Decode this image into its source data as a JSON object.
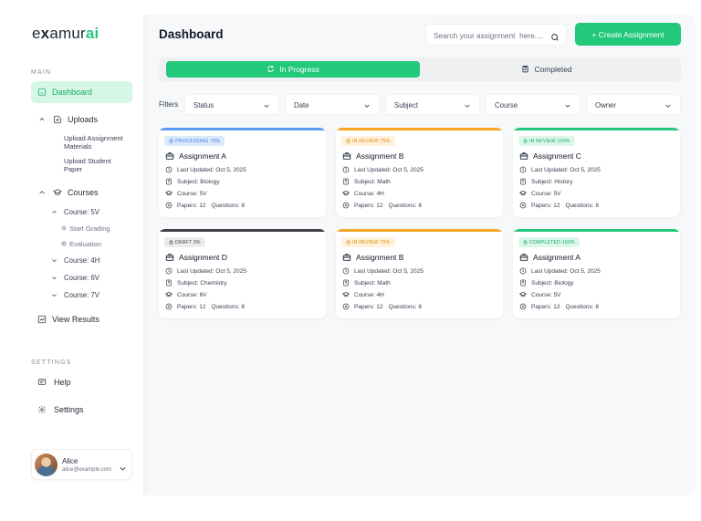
{
  "brand": {
    "prefix": "e",
    "x": "x",
    "middle": "amur",
    "suffix": "ai"
  },
  "sidebar": {
    "main_label": "MAIN",
    "dashboard": "Dashboard",
    "uploads": "Uploads",
    "upload_assignment": "Upload Assignment Materials",
    "upload_student": "Upload Student Paper",
    "courses": "Courses",
    "course_5v": "Course: 5V",
    "start_grading": "Start Grading",
    "evaluation": "Evaluation",
    "course_4h": "Course: 4H",
    "course_6v": "Course: 6V",
    "course_7v": "Course: 7V",
    "view_results": "View Results",
    "settings_label": "SETTINGS",
    "help": "Help",
    "settings": "Settings"
  },
  "user": {
    "name": "Alice",
    "email": "alice@example.com"
  },
  "header": {
    "title": "Dashboard",
    "search_placeholder": "Search your assignment  here....",
    "create_label": "+ Create Assignment"
  },
  "tabs": {
    "in_progress": "In Progress",
    "completed": "Completed"
  },
  "filters": {
    "label": "Filters",
    "items": [
      "Status",
      "Date",
      "Subject",
      "Course",
      "Owner"
    ]
  },
  "colors": {
    "accent": "#22c97a",
    "blue": "#5b9cf2",
    "orange": "#f59e0b",
    "dark": "#3f3f46",
    "green": "#22c97a"
  },
  "cards": [
    {
      "badge": "PROCESSING 75%",
      "title": "Assignment A",
      "updated": "Last Updated: Oct 5, 2025",
      "subject": "Subject: Biology",
      "course": "Course: 5V",
      "papers": "Papers: 12",
      "questions": "Questions: 8"
    },
    {
      "badge": "IN REVIEW 75%",
      "title": "Assignment B",
      "updated": "Last Updated: Oct 5, 2025",
      "subject": "Subject: Math",
      "course": "Course: 4H",
      "papers": "Papers: 12",
      "questions": "Questions: 8"
    },
    {
      "badge": "IN REVIEW 100%",
      "title": "Assignment C",
      "updated": "Last Updated: Oct 5, 2025",
      "subject": "Subject: History",
      "course": "Course: 5V",
      "papers": "Papers: 12",
      "questions": "Questions: 8"
    },
    {
      "badge": "DRAFT 0%",
      "title": "Assignment D",
      "updated": "Last Updated: Oct 5, 2025",
      "subject": "Subject: Chemistry",
      "course": "Course: 6V",
      "papers": "Papers: 12",
      "questions": "Questions: 8"
    },
    {
      "badge": "IN REVIEW 75%",
      "title": "Assignment B",
      "updated": "Last Updated: Oct 5, 2025",
      "subject": "Subject: Math",
      "course": "Course: 4H",
      "papers": "Papers: 12",
      "questions": "Questions: 8"
    },
    {
      "badge": "COMPLETED 100%",
      "title": "Assignment A",
      "updated": "Last Updated: Oct 5, 2025",
      "subject": "Subject: Biology",
      "course": "Course: 5V",
      "papers": "Papers: 12",
      "questions": "Questions: 8"
    }
  ]
}
